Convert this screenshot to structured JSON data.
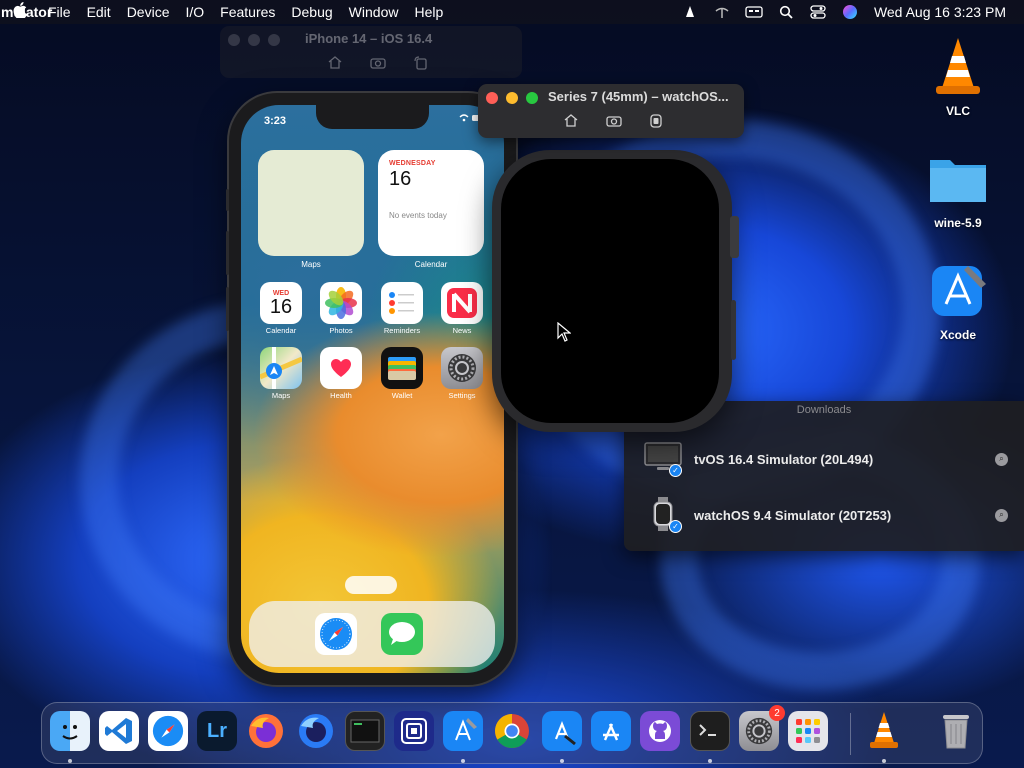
{
  "menubar": {
    "app_name": "Simulator",
    "items": [
      "File",
      "Edit",
      "Device",
      "I/O",
      "Features",
      "Debug",
      "Window",
      "Help"
    ],
    "clock": "Wed Aug 16  3:23 PM"
  },
  "iphone_window": {
    "title": "iPhone 14 – iOS 16.4",
    "status_time": "3:23",
    "widgets": {
      "maps_label": "Maps",
      "calendar_label": "Calendar",
      "calendar_day": "WEDNESDAY",
      "calendar_date": "16",
      "calendar_events": "No events today"
    },
    "apps": [
      {
        "label": "Calendar",
        "day": "WED",
        "date": "16"
      },
      {
        "label": "Photos"
      },
      {
        "label": "Reminders"
      },
      {
        "label": "News"
      },
      {
        "label": "Maps"
      },
      {
        "label": "Health"
      },
      {
        "label": "Wallet"
      },
      {
        "label": "Settings"
      }
    ],
    "dock_apps": [
      "safari-icon",
      "messages-icon"
    ]
  },
  "watch_window": {
    "title": "Series 7 (45mm) – watchOS..."
  },
  "downloads": {
    "title": "Downloads",
    "items": [
      {
        "name": "tvOS 16.4 Simulator (20L494)",
        "icon": "appletv-icon"
      },
      {
        "name": "watchOS 9.4 Simulator (20T253)",
        "icon": "watch-icon"
      }
    ]
  },
  "desktop": {
    "icons": [
      {
        "label": "VLC"
      },
      {
        "label": "wine-5.9"
      },
      {
        "label": "Xcode"
      }
    ]
  },
  "dock": {
    "apps": [
      "finder",
      "vscode",
      "safari",
      "lightroom",
      "firefox",
      "firefox-dev",
      "terminal-mini",
      "simulator-launcher",
      "xcode",
      "chrome",
      "instruments",
      "app-store",
      "github-desktop",
      "terminal",
      "system-settings",
      "launchpad",
      "vlc",
      "trash"
    ],
    "system_settings_badge": "2",
    "lightroom_text": "Lr"
  },
  "colors": {
    "accent": "#1a86f5",
    "close": "#ff5f57",
    "minimize": "#febc2e",
    "zoom": "#28c840"
  }
}
